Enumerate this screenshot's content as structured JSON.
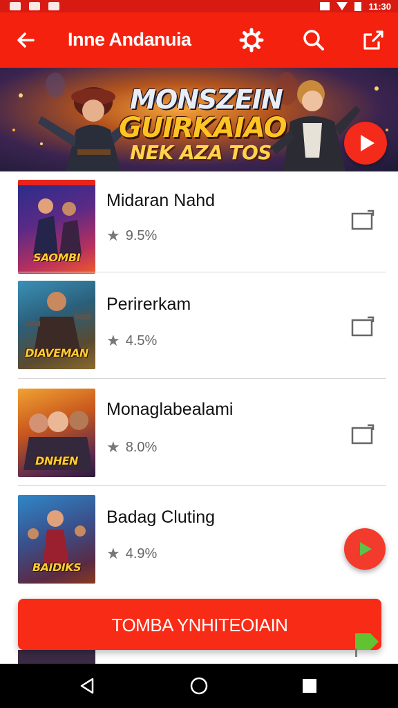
{
  "status_bar": {
    "time": "11:30"
  },
  "toolbar": {
    "title": "Inne Andanuia",
    "icons": [
      "back-arrow-icon",
      "settings-gear-icon",
      "search-icon",
      "share-icon"
    ]
  },
  "banner": {
    "line1": "MONSZEIN",
    "line2": "GUIRKAIAO",
    "line3": "NEK AZA TOS"
  },
  "items": [
    {
      "title": "Midaran Nahd",
      "rating": "9.5%",
      "thumb_text": "SAOMBI"
    },
    {
      "title": "Perirerkam",
      "rating": "4.5%",
      "thumb_text": "DIAVEMAN"
    },
    {
      "title": "Monaglabealami",
      "rating": "8.0%",
      "thumb_text": "DNHEN"
    },
    {
      "title": "Badag Cluting",
      "rating": "4.9%",
      "thumb_text": "BAIDIKS"
    }
  ],
  "cta": {
    "label": "TOMBA YNHITEOIAIN"
  },
  "colors": {
    "primary": "#f5210f",
    "status": "#d81b12",
    "fab": "#f23b2c",
    "play_green": "#4caf50"
  }
}
